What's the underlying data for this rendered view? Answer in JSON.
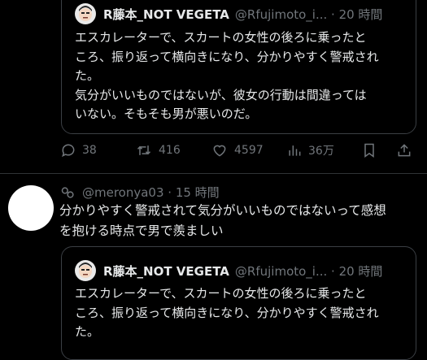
{
  "quoted_tweet": {
    "name": "R藤本_NOT VEGETA",
    "handle_time": "@Rfujimoto_i... · 20 時間",
    "text": "エスカレーターで、スカートの女性の後ろに乗ったと\nころ、振り返って横向きになり、分かりやすく警戒され\nた。\n気分がいいものではないが、彼女の行動は間違っては\nいない。そもそも男が悪いのだ。"
  },
  "actions": {
    "replies": "38",
    "retweets": "416",
    "likes": "4597",
    "views": "36万"
  },
  "reply": {
    "handle_time": "@meronya03 · 15 時間",
    "text": "分かりやすく警戒されて気分がいいものではないって感想\nを抱ける時点で男で羨ましい"
  },
  "quoted_tweet_2": {
    "name": "R藤本_NOT VEGETA",
    "handle_time": "@Rfujimoto_i... · 20 時間",
    "text": "エスカレーターで、スカートの女性の後ろに乗ったと\nころ、振り返って横向きになり、分かりやすく警戒され\nた。"
  }
}
